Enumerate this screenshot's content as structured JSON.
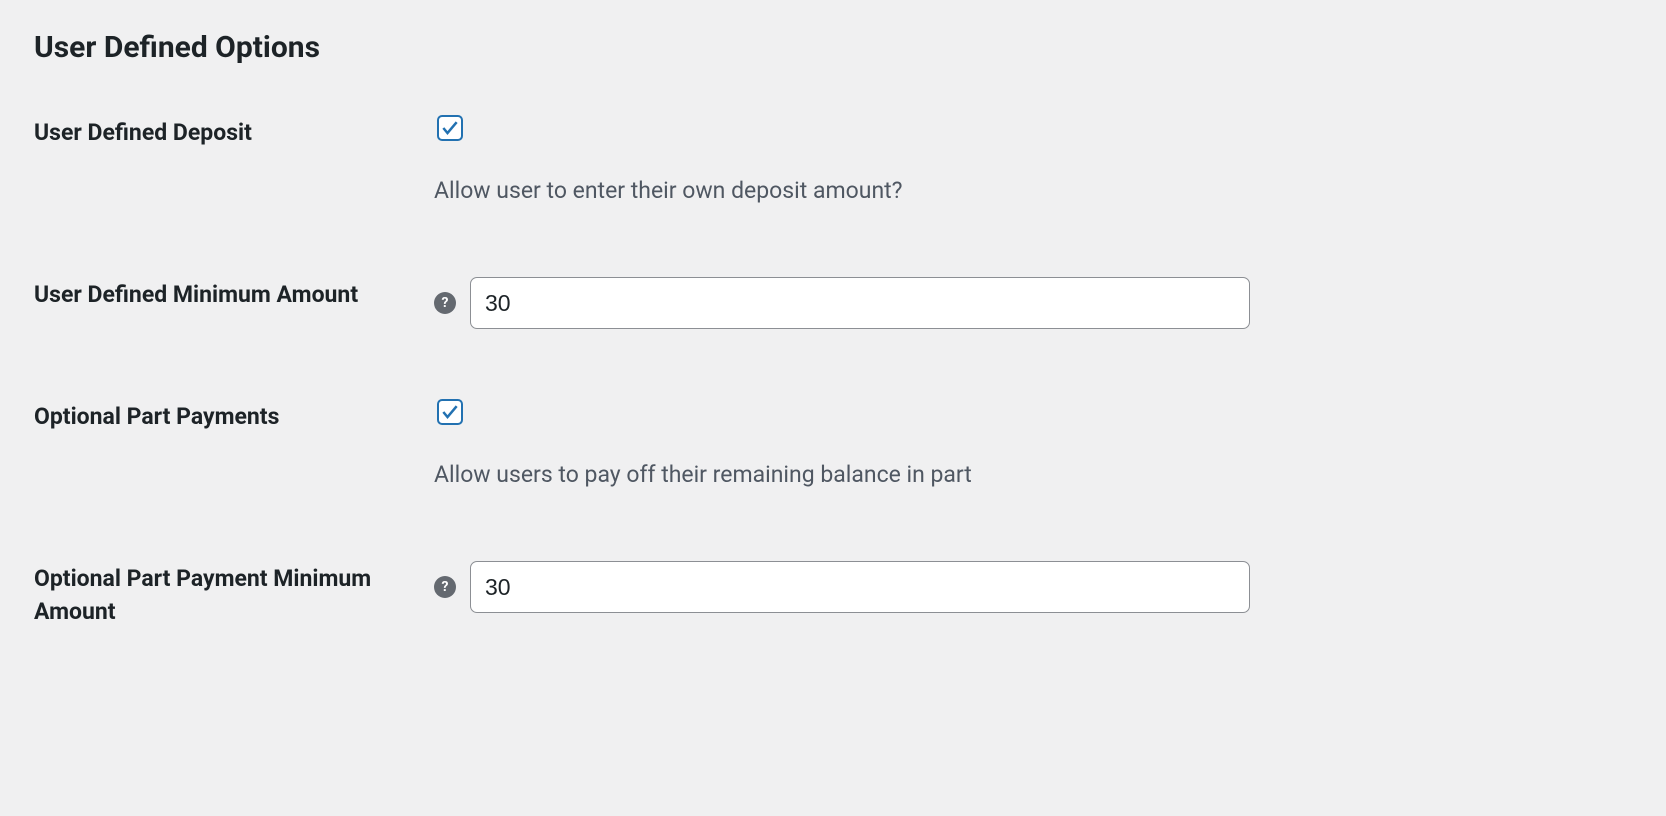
{
  "section": {
    "title": "User Defined Options"
  },
  "fields": {
    "user_defined_deposit": {
      "label": "User Defined Deposit",
      "checked": true,
      "description": "Allow user to enter their own deposit amount?"
    },
    "user_defined_minimum_amount": {
      "label": "User Defined Minimum Amount",
      "value": "30"
    },
    "optional_part_payments": {
      "label": "Optional Part Payments",
      "checked": true,
      "description": "Allow users to pay off their remaining balance in part"
    },
    "optional_part_payment_minimum_amount": {
      "label": "Optional Part Payment Minimum Amount",
      "value": "30"
    }
  }
}
